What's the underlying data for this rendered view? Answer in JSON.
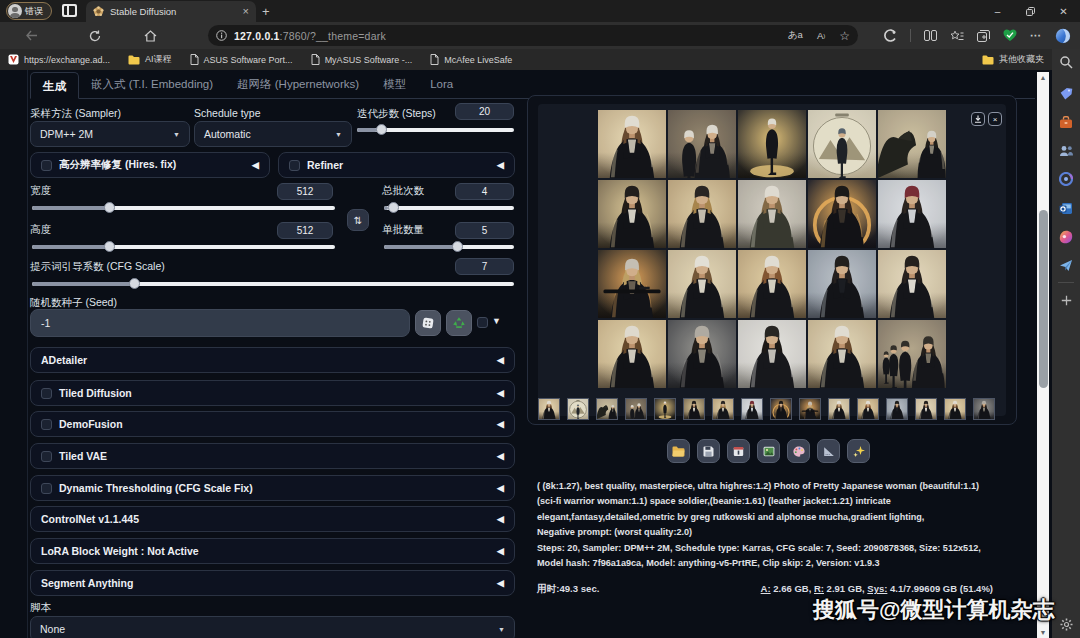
{
  "browser": {
    "profile_label": "错误",
    "tab_title": "Stable Diffusion",
    "new_tab_glyph": "+",
    "close_glyph": "×",
    "window_controls": {
      "minimize": "–",
      "restore": "❐",
      "close": "✕"
    },
    "url": {
      "host": "127.0.0.1",
      "rest": ":7860/?__theme=dark"
    },
    "bookmarks": [
      {
        "label": "https://exchange.ad...",
        "icon": "shield-red"
      },
      {
        "label": "AI课程",
        "icon": "folder"
      },
      {
        "label": "ASUS Software Port...",
        "icon": "page"
      },
      {
        "label": "MyASUS Software -...",
        "icon": "page"
      },
      {
        "label": "McAfee LiveSafe",
        "icon": "page"
      }
    ],
    "other_favorites": "其他收藏夹"
  },
  "app": {
    "tabs": [
      {
        "label": "生成",
        "active": true
      },
      {
        "label": "嵌入式 (T.I. Embedding)",
        "active": false
      },
      {
        "label": "超网络 (Hypernetworks)",
        "active": false
      },
      {
        "label": "模型",
        "active": false
      },
      {
        "label": "Lora",
        "active": false
      }
    ],
    "sampler": {
      "label": "采样方法 (Sampler)",
      "value": "DPM++ 2M"
    },
    "schedule": {
      "label": "Schedule type",
      "value": "Automatic"
    },
    "steps": {
      "label": "迭代步数 (Steps)",
      "value": "20",
      "percent": 12.8
    },
    "hires": {
      "label": "高分辨率修复 (Hires. fix)"
    },
    "refiner": {
      "label": "Refiner"
    },
    "width": {
      "label": "宽度",
      "value": "512",
      "percent": 24.6
    },
    "height": {
      "label": "高度",
      "value": "512",
      "percent": 24.6
    },
    "batch_count": {
      "label": "总批次数",
      "value": "4",
      "percent": 3.0
    },
    "batch_size": {
      "label": "单批数量",
      "value": "5",
      "percent": 57.1
    },
    "cfg": {
      "label": "提示词引导系数 (CFG Scale)",
      "value": "7",
      "percent": 20.7
    },
    "seed": {
      "label": "随机数种子 (Seed)",
      "value": "-1"
    },
    "accordions": [
      {
        "label": "ADetailer",
        "checkbox": false
      },
      {
        "label": "Tiled Diffusion",
        "checkbox": true
      },
      {
        "label": "DemoFusion",
        "checkbox": true
      },
      {
        "label": "Tiled VAE",
        "checkbox": true
      },
      {
        "label": "Dynamic Thresholding (CFG Scale Fix)",
        "checkbox": true
      },
      {
        "label": "ControlNet v1.1.445",
        "checkbox": false
      },
      {
        "label": "LoRA Block Weight : Not Active",
        "checkbox": false
      },
      {
        "label": "Segment Anything",
        "checkbox": false
      }
    ],
    "script": {
      "label": "脚本",
      "value": "None"
    }
  },
  "gallery": {
    "images": [
      {
        "v": "bust",
        "sky": "#cbb793",
        "glow": "#f2e3bd",
        "ground": "#5e5240",
        "beanie": "#ece8dd",
        "hair": "#6e4f33",
        "jacket": "#15161a",
        "shirt": "#c9c2b4"
      },
      {
        "v": "duo",
        "sky": "#6e6457",
        "glow": "#9c8d74",
        "ground": "#2c2a26",
        "beanie": "#e6e2d8",
        "hair": "#2a2420",
        "jacket": "#191a1e",
        "shirt": "#8d8578"
      },
      {
        "v": "full",
        "sky": "#3a3732",
        "glow": "#e8c87e",
        "ground": "#191713",
        "beanie": "#e9e5da",
        "hair": "#d8d3c8",
        "jacket": "#17181c",
        "shirt": "#b9b2a3"
      },
      {
        "v": "sphere",
        "sky": "#d9d2bd",
        "glow": "#efe9d2",
        "ground": "#b9ae92",
        "beanie": "#5d6a74",
        "hair": "#3e4a54",
        "jacket": "#20242a",
        "shirt": "#9aa0a4"
      },
      {
        "v": "creature",
        "sky": "#b3a78e",
        "glow": "#d6c9a8",
        "ground": "#57503f",
        "beanie": "#dfdcd2",
        "hair": "#23201c",
        "jacket": "#16171b",
        "shirt": "#8e887a"
      },
      {
        "v": "bust",
        "sky": "#8a7b60",
        "glow": "#e3cf9d",
        "ground": "#302a20",
        "beanie": "#23201e",
        "hair": "#241e19",
        "jacket": "#141519",
        "shirt": "#ddd8cc"
      },
      {
        "v": "bust",
        "sky": "#c2ab85",
        "glow": "#e8d7ae",
        "ground": "#4e4332",
        "beanie": "#2c2825",
        "hair": "#b08d52",
        "jacket": "#17181c",
        "shirt": "#cfc8b8"
      },
      {
        "v": "bust",
        "sky": "#b9b4a9",
        "glow": "#ded9cc",
        "ground": "#55524a",
        "beanie": "#eae6dc",
        "hair": "#8b6f4a",
        "jacket": "#3a3c32",
        "shirt": "#d4cfc3"
      },
      {
        "v": "halo",
        "sky": "#2e2c31",
        "glow": "#f0b45e",
        "ground": "#141318",
        "beanie": "#1d1b1a",
        "hair": "#37291f",
        "jacket": "#131418",
        "shirt": "#3a332c"
      },
      {
        "v": "bust",
        "sky": "#c9cdd2",
        "glow": "#e9ebee",
        "ground": "#6b6e74",
        "beanie": "#7e3038",
        "hair": "#2f2722",
        "jacket": "#17181c",
        "shirt": "#d9dbde"
      },
      {
        "v": "rifle",
        "sky": "#3b342b",
        "glow": "#e9a95e",
        "ground": "#171410",
        "beanie": "#cfc9bd",
        "hair": "#c8a86a",
        "jacket": "#15161a",
        "shirt": "#6e6556"
      },
      {
        "v": "bust",
        "sky": "#cfc0a0",
        "glow": "#eee1c0",
        "ground": "#6b5f49",
        "beanie": "#efebe1",
        "hair": "#7a5c3b",
        "jacket": "#16171b",
        "shirt": "#e3decf"
      },
      {
        "v": "bust",
        "sky": "#c4ad86",
        "glow": "#ecd9ad",
        "ground": "#584a36",
        "beanie": "#ece8de",
        "hair": "#8a5b35",
        "jacket": "#17181c",
        "shirt": "#ded8c9"
      },
      {
        "v": "bust",
        "sky": "#9aa3ad",
        "glow": "#c7cdd4",
        "ground": "#4a4f58",
        "beanie": "#23211f",
        "hair": "#272220",
        "jacket": "#15161a",
        "shirt": "#1d1f24"
      },
      {
        "v": "bust",
        "sky": "#d3c4a6",
        "glow": "#f0e5c8",
        "ground": "#6f6350",
        "beanie": "#26221f",
        "hair": "#2b2420",
        "jacket": "#17181c",
        "shirt": "#e8e4da"
      },
      {
        "v": "bust",
        "sky": "#cdb78f",
        "glow": "#efe0b7",
        "ground": "#5f5340",
        "beanie": "#eae5d9",
        "hair": "#6b4c2e",
        "jacket": "#141519",
        "shirt": "#d8d2c4"
      },
      {
        "v": "bust",
        "sky": "#56575a",
        "glow": "#9d9c97",
        "ground": "#232427",
        "beanie": "#b9b4aa",
        "hair": "#26211d",
        "jacket": "#141519",
        "shirt": "#8e887c"
      },
      {
        "v": "bust",
        "sky": "#d6d4cf",
        "glow": "#efeeea",
        "ground": "#7c7a74",
        "beanie": "#2a2724",
        "hair": "#1f1b18",
        "jacket": "#191a1e",
        "shirt": "#cbc7bf"
      },
      {
        "v": "bust",
        "sky": "#cdbc9a",
        "glow": "#eee2c2",
        "ground": "#5d513e",
        "beanie": "#ece8dd",
        "hair": "#6f4f30",
        "jacket": "#16171b",
        "shirt": "#d9d3c5"
      },
      {
        "v": "group",
        "sky": "#8d8271",
        "glow": "#bcae92",
        "ground": "#3a352c",
        "beanie": "#35322d",
        "hair": "#26221e",
        "jacket": "#17181c",
        "shirt": "#7f7868"
      }
    ],
    "thumbs": [
      0,
      3,
      4,
      1,
      2,
      5,
      6,
      9,
      8,
      10,
      11,
      12,
      13,
      14,
      15,
      16
    ],
    "download_glyph": "⬇",
    "close_glyph": "×"
  },
  "output": {
    "buttons": [
      {
        "name": "open-folder",
        "icon": "folder"
      },
      {
        "name": "save",
        "icon": "floppy"
      },
      {
        "name": "save-zip",
        "icon": "zip"
      },
      {
        "name": "send-to-img2img",
        "icon": "image"
      },
      {
        "name": "send-to-inpaint",
        "icon": "palette"
      },
      {
        "name": "send-to-extras",
        "icon": "ruler"
      },
      {
        "name": "upscale",
        "icon": "sparkle"
      }
    ],
    "prompt": "( (8k:1.27), best quality, masterpiece, ultra highres:1.2) Photo of Pretty Japanese woman (beautiful:1.1) (sci-fi warrior woman:1.1) space soldier,(beanie:1.61) (leather jacket:1.21) intricate elegant,fantasy,detailed,ometric by greg rutkowski and alphonse mucha,gradient lighting,",
    "negative": "Negative prompt: (worst quality:2.0)",
    "params": "Steps: 20, Sampler: DPM++ 2M, Schedule type: Karras, CFG scale: 7, Seed: 2090878368, Size: 512x512, Model hash: 7f96a1a9ca, Model: anything-v5-PrtRE, Clip skip: 2, Version: v1.9.3",
    "time": "用时:49.3 sec.",
    "memory": {
      "a_label": "A:",
      "a": " 2.66 GB, ",
      "r_label": "R:",
      "r": " 2.91 GB, ",
      "sys_label": "Sys:",
      "sys": " 4.1/7.99609 GB ",
      "pct": "(51.4%)"
    }
  },
  "watermark": "搜狐号@微型计算机杂志",
  "sidebar": {
    "items": [
      "search",
      "shopping-tag",
      "m365",
      "people",
      "games",
      "outlook",
      "designer",
      "drop",
      "plus"
    ],
    "bottom": "settings-gear"
  }
}
